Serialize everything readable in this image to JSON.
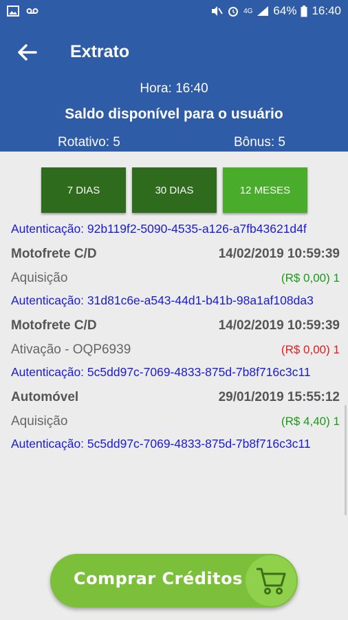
{
  "statusbar": {
    "battery": "64%",
    "time": "16:40",
    "network": "4G",
    "icons": [
      "image-icon",
      "voicemail-icon",
      "mute-icon",
      "alarm-icon",
      "signal-icon",
      "battery-icon"
    ]
  },
  "header": {
    "title": "Extrato",
    "hora": "Hora: 16:40",
    "saldo_title": "Saldo disponível para o usuário",
    "rotativo": "Rotativo: 5",
    "bonus": "Bônus: 5"
  },
  "filters": [
    {
      "label": "7 DIAS",
      "active": false
    },
    {
      "label": "30 DIAS",
      "active": false
    },
    {
      "label": "12 MESES",
      "active": true
    }
  ],
  "list": {
    "top_auth": "Autenticação: 92b119f2-5090-4535-a126-a7fb43621d4f",
    "items": [
      {
        "name": "Motofrete C/D",
        "datetime": "14/02/2019 10:59:39",
        "kind": "Aquisição",
        "amount": "(R$ 0,00)",
        "qty": "1",
        "amount_color": "green",
        "auth": "Autenticação: 31d81c6e-a543-44d1-b41b-98a1af108da3"
      },
      {
        "name": "Motofrete C/D",
        "datetime": "14/02/2019 10:59:39",
        "kind": "Ativação - OQP6939",
        "amount": "(R$ 0,00)",
        "qty": "1",
        "amount_color": "red",
        "auth": "Autenticação: 5c5dd97c-7069-4833-875d-7b8f716c3c11"
      },
      {
        "name": "Automóvel",
        "datetime": "29/01/2019 15:55:12",
        "kind": "Aquisição",
        "amount": "(R$ 4,40)",
        "qty": "1",
        "amount_color": "green",
        "auth": "Autenticação: 5c5dd97c-7069-4833-875d-7b8f716c3c11"
      }
    ]
  },
  "buy_button": {
    "label": "Comprar Créditos"
  },
  "colors": {
    "primary": "#2f5ca7",
    "filter_dark": "#2e6b1c",
    "filter_active": "#49ad2b",
    "buy": "#7cbf3a",
    "auth_text": "#1b1bd1",
    "green": "#1a9a1a",
    "red": "#e01d1d"
  }
}
